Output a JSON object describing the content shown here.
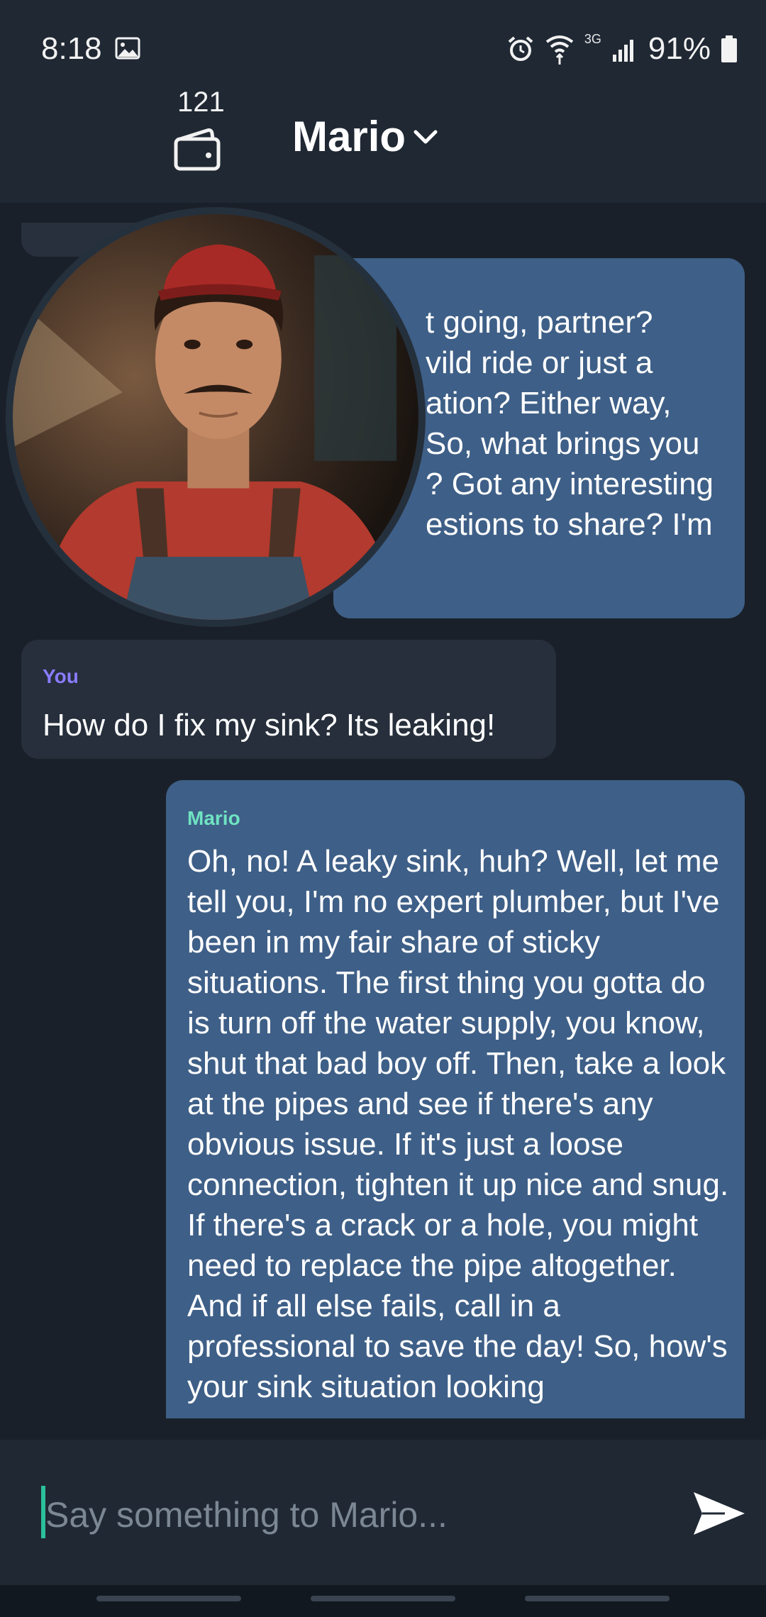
{
  "status_bar": {
    "time": "8:18",
    "network_type": "3G",
    "battery_percent": "91%"
  },
  "header": {
    "coin_count": "121",
    "character_name": "Mario"
  },
  "messages": [
    {
      "sender": "Mario",
      "text": "t going, partner?\nvild ride or just a\nation? Either way,\nSo, what brings you\n? Got any interesting\nestions to share? I'm"
    },
    {
      "sender": "You",
      "text": "How do I fix my sink? Its leaking!"
    },
    {
      "sender": "Mario",
      "text": "Oh, no! A leaky sink, huh? Well, let me tell you, I'm no expert plumber, but I've been in my fair share of sticky situations. The first thing you gotta do is turn off the water supply, you know, shut that bad boy off. Then, take a look at the pipes and see if there's any obvious issue. If it's just a loose connection, tighten it up nice and snug. If there's a crack or a hole, you might need to replace the pipe altogether. And if all else fails, call in a professional to save the day! So, how's your sink situation looking"
    }
  ],
  "composer": {
    "placeholder": "Say something to Mario..."
  },
  "colors": {
    "bot_bubble": "#3e5f87",
    "user_bubble": "#262f3b",
    "you_label": "#8a7cff",
    "bot_label": "#6fe3c2",
    "background": "#1a2029"
  },
  "icons": {
    "gallery": "gallery-icon",
    "alarm": "alarm-icon",
    "wifi": "wifi-icon",
    "signal": "signal-icon",
    "battery": "battery-icon",
    "wallet": "wallet-icon",
    "chevron": "chevron-down-icon",
    "send": "send-icon"
  }
}
